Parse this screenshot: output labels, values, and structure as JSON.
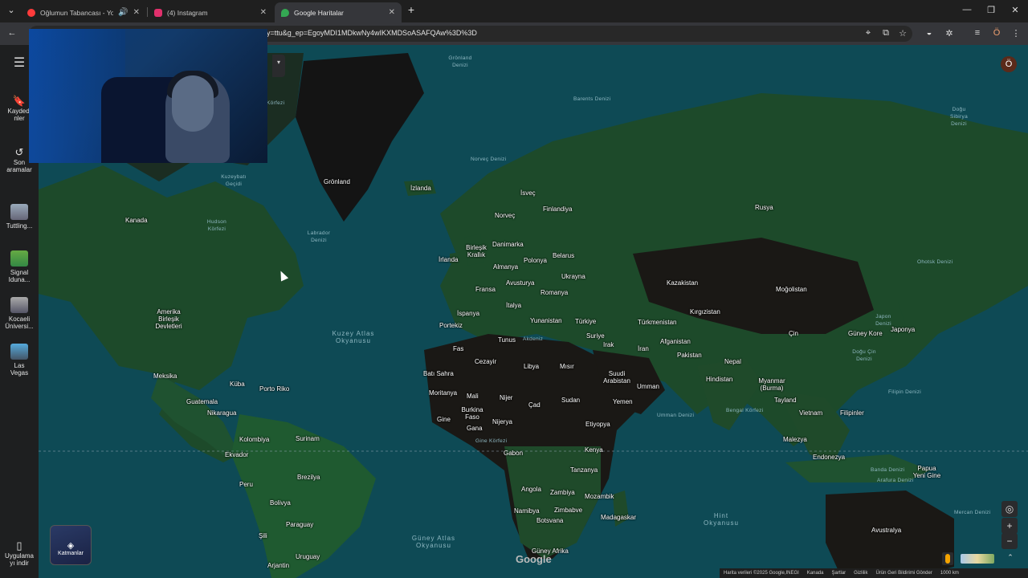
{
  "tabs": [
    {
      "title": "Oğlumun Tabancası - YouTu",
      "favicon_color": "#ff3b3b"
    },
    {
      "title": "(4) Instagram",
      "favicon_color": "#e1306c"
    },
    {
      "title": "Google Haritalar",
      "favicon_color": "#34a853"
    }
  ],
  "toolbar": {
    "url_visible": "y=ttu&g_ep=EgoyMDI1MDkwNy4wIKXMDSoASAFQAw%3D%3D"
  },
  "sidebar": {
    "items": [
      {
        "label": "Kaydedi\nnler"
      },
      {
        "label": "Son\naramalar"
      },
      {
        "label": "Tuttling..."
      },
      {
        "label": "Signal\nIduna..."
      },
      {
        "label": "Kocaeli\nÜniversi..."
      },
      {
        "label": "Las\nVegas"
      },
      {
        "label": "Uygulama\nyı indir"
      }
    ]
  },
  "layers": {
    "label": "Katmanlar"
  },
  "profile": {
    "initial": "Ö"
  },
  "map_labels": {
    "countries": [
      "Grönland",
      "Kanada",
      "Amerika Birleşik Devletleri",
      "Meksika",
      "Küba",
      "Guatemala",
      "Nikaragua",
      "Porto Riko",
      "Kolombiya",
      "Surinam",
      "Ekvador",
      "Peru",
      "Brezilya",
      "Bolivya",
      "Paraguay",
      "Şili",
      "Uruguay",
      "Arjantin",
      "İzlanda",
      "İsveç",
      "Finlandiya",
      "Norveç",
      "Danimarka",
      "Birleşik Krallık",
      "İrlanda",
      "Polonya",
      "Belarus",
      "Almanya",
      "Fransa",
      "Avusturya",
      "Ukrayna",
      "Romanya",
      "İtalya",
      "İspanya",
      "Portekiz",
      "Yunanistan",
      "Türkiye",
      "Rusya",
      "Kazakistan",
      "Moğolistan",
      "Kırgızistan",
      "Türkmenistan",
      "Suriye",
      "Irak",
      "İran",
      "Afganistan",
      "Pakistan",
      "Nepal",
      "Hindistan",
      "Çin",
      "Güney Kore",
      "Japonya",
      "Myanmar (Burma)",
      "Tayland",
      "Vietnam",
      "Filipinler",
      "Malezya",
      "Endonezya",
      "Papua Yeni Gine",
      "Avustralya",
      "Tunus",
      "Fas",
      "Cezayir",
      "Libya",
      "Mısır",
      "Batı Sahra",
      "Moritanya",
      "Mali",
      "Nijer",
      "Çad",
      "Sudan",
      "Suudi Arabistan",
      "Umman",
      "Yemen",
      "Burkina Faso",
      "Gine",
      "Gana",
      "Nijerya",
      "Etiyopya",
      "Kenya",
      "Gabon",
      "Tanzanya",
      "Angola",
      "Zambiya",
      "Mozambik",
      "Namibya",
      "Zimbabve",
      "Botsvana",
      "Madagaskar",
      "Güney Afrika"
    ],
    "seas": [
      "Grönland Denizi",
      "Barents Denizi",
      "Doğu Sibirya Denizi",
      "Norveç Denizi",
      "Kuzey Atlas Okyanusu",
      "Labrador Denizi",
      "Hudson Körfezi",
      "Kuzeybatı Geçidi",
      "Ohotsk Denizi",
      "Japon Denizi",
      "Doğu Çin Denizi",
      "Filipin Denizi",
      "Umman Denizi",
      "Bengal Körfezi",
      "Gine Körfezi",
      "Banda Denizi",
      "Arafura Denizi",
      "Mercan Denizi",
      "Güney Atlas Okyanusu",
      "Hint Okyanusu",
      "Akdeniz",
      "Körfezi"
    ]
  },
  "footer": {
    "items": [
      "Harita verileri ©2025 Google,INEGI",
      "Kanada",
      "Şartlar",
      "Gizlilik",
      "Ürün Geri Bildirimi Gönder",
      "1000 km"
    ]
  },
  "brand": {
    "logo_text": "Google"
  },
  "colors": {
    "ocean": "#0e4a55",
    "land": "#1d4a2a",
    "desert": "#1a1815",
    "ice": "#151515"
  }
}
